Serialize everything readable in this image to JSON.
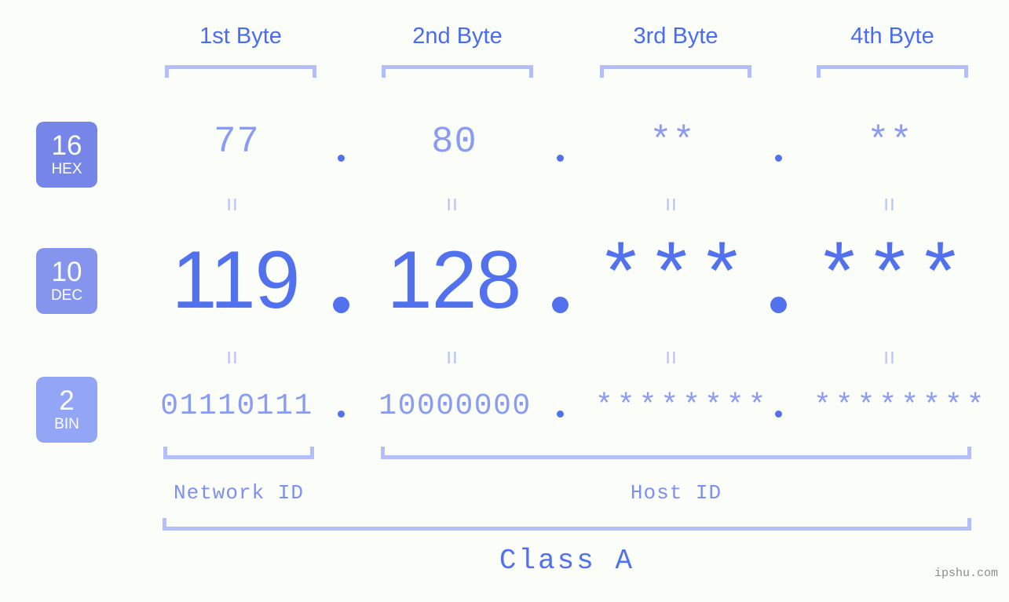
{
  "meta": {
    "background": "#fbfdf8",
    "accent_strong": "#5271ef",
    "accent_light": "#8a9bf4",
    "bracket_color": "#b4bffa"
  },
  "byte_headers": [
    {
      "label": "1st Byte"
    },
    {
      "label": "2nd Byte"
    },
    {
      "label": "3rd Byte"
    },
    {
      "label": "4th Byte"
    }
  ],
  "bases": [
    {
      "number": "16",
      "name": "HEX",
      "color": "#7686e8"
    },
    {
      "number": "10",
      "name": "DEC",
      "color": "#8595ee"
    },
    {
      "number": "2",
      "name": "BIN",
      "color": "#93a6f5"
    }
  ],
  "rows": {
    "hex": {
      "values": [
        "77",
        "80",
        "**",
        "**"
      ],
      "separator": "."
    },
    "dec": {
      "values": [
        "119",
        "128",
        "***",
        "***"
      ],
      "separator": "."
    },
    "bin": {
      "values": [
        "01110111",
        "10000000",
        "********",
        "********"
      ],
      "separator": "."
    }
  },
  "equals_symbol": "=",
  "sections": {
    "network_id": "Network ID",
    "host_id": "Host ID",
    "class": "Class A"
  },
  "watermark": "ipshu.com"
}
